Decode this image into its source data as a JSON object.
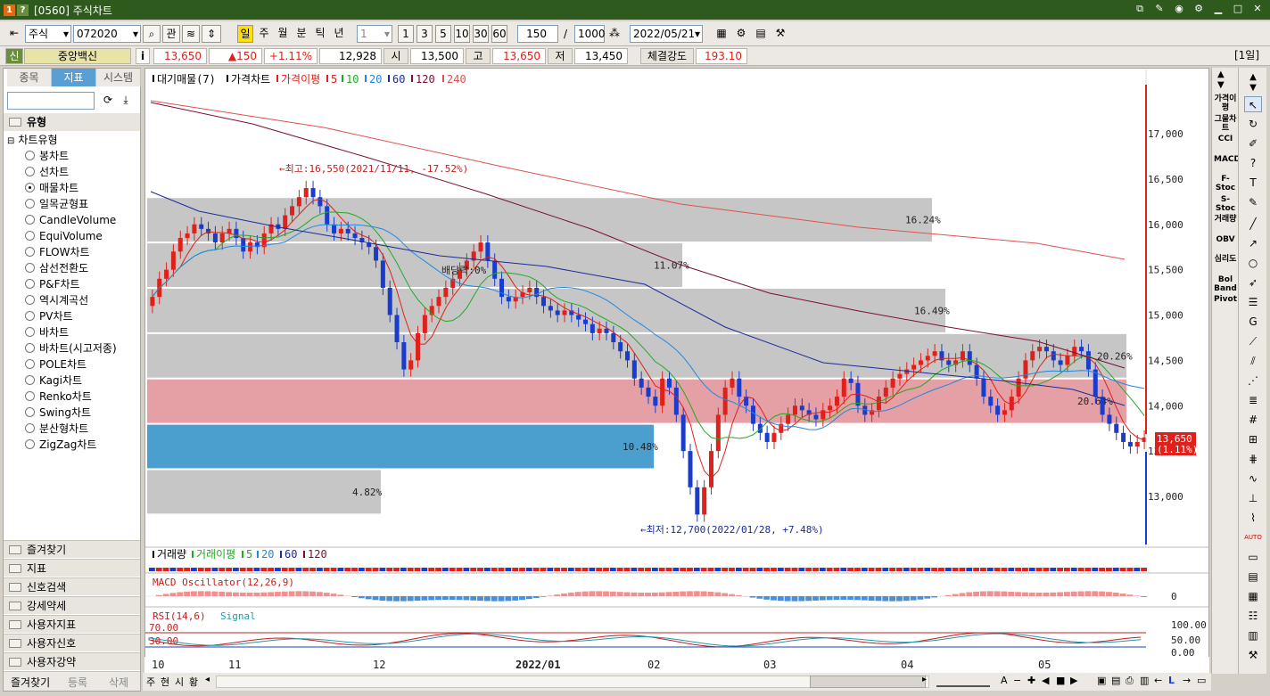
{
  "window": {
    "icon1": "1",
    "icon2": "?",
    "title": "[0560] 주식차트"
  },
  "toolbar": {
    "market": "주식",
    "code": "072020",
    "btn_gwan": "관",
    "periods": [
      "일",
      "주",
      "월",
      "분",
      "틱",
      "년"
    ],
    "interval_value": "1",
    "intervals": [
      "1",
      "3",
      "5",
      "10",
      "30",
      "60"
    ],
    "count": "150",
    "slash": "/",
    "total": "1000",
    "date": "2022/05/21"
  },
  "quote": {
    "badge": "신",
    "name": "중앙백신",
    "info": "i",
    "price": "13,650",
    "change": "▲150",
    "change_pct": "+1.11%",
    "volume": "12,928",
    "open_label": "시",
    "open": "13,500",
    "high_label": "고",
    "high": "13,650",
    "low_label": "저",
    "low": "13,450",
    "strength_label": "체결강도",
    "strength": "193.10",
    "period_badge": "[1일]"
  },
  "left_panel": {
    "tabs": [
      "종목",
      "지표",
      "시스템"
    ],
    "active_tab": "지표",
    "group_title": "유형",
    "subgroup": "차트유형",
    "chart_types": [
      "봉차트",
      "선차트",
      "매물차트",
      "일목균형표",
      "CandleVolume",
      "EquiVolume",
      "FLOW차트",
      "삼선전환도",
      "P&F차트",
      "역시계곡선",
      "PV차트",
      "바차트",
      "바차트(시고저종)",
      "POLE차트",
      "Kagi차트",
      "Renko차트",
      "Swing차트",
      "분산형차트",
      "ZigZag차트"
    ],
    "selected_type": "매물차트",
    "folders": [
      "즐겨찾기",
      "지표",
      "신호검색",
      "강세약세",
      "사용자지표",
      "사용자신호",
      "사용자강약"
    ],
    "footer": [
      "즐겨찾기",
      "등록",
      "삭제"
    ]
  },
  "chart": {
    "legend_main": [
      {
        "text": "대기매물(7)",
        "color": "#000000"
      },
      {
        "text": "가격차트",
        "color": "#000000"
      },
      {
        "text": "가격이평",
        "color": "#e0201a"
      },
      {
        "text": "5",
        "color": "#e0201a"
      },
      {
        "text": "10",
        "color": "#22aa22"
      },
      {
        "text": "20",
        "color": "#2288dd"
      },
      {
        "text": "60",
        "color": "#1a2c99"
      },
      {
        "text": "120",
        "color": "#7a1030"
      },
      {
        "text": "240",
        "color": "#e05050"
      }
    ],
    "legend_volume": [
      {
        "text": "거래량",
        "color": "#000000"
      },
      {
        "text": "거래이평",
        "color": "#22aa22"
      },
      {
        "text": "5",
        "color": "#22aa22"
      },
      {
        "text": "20",
        "color": "#2288dd"
      },
      {
        "text": "60",
        "color": "#1a2c99"
      },
      {
        "text": "120",
        "color": "#7a1030"
      }
    ],
    "legend_macd": "MACD Oscillator(12,26,9)",
    "macd_zero": "0",
    "legend_rsi": "RSI(14,6)",
    "legend_signal": "Signal",
    "rsi_levels": [
      "70.00",
      "30.00"
    ],
    "rsi_axis": [
      "100.00",
      "50.00",
      "0.00"
    ],
    "price_axis": [
      "17,000",
      "16,500",
      "16,000",
      "15,500",
      "15,000",
      "14,500",
      "14,000",
      "13,500",
      "13,000"
    ],
    "current_price_tag": "13,650",
    "current_pct_tag": "(1.11%)",
    "annotations": {
      "high": "←최고:16,550(2021/11/11, -17.52%)",
      "low": "←최저:12,700(2022/01/28, +7.48%)",
      "dividend": "배당락:0%"
    },
    "supply_pct": [
      "16.24%",
      "11.07%",
      "16.49%",
      "20.26%",
      "20.64%",
      "10.48%",
      "4.82%"
    ],
    "x_labels": [
      "10",
      "11",
      "12",
      "2022/01",
      "02",
      "03",
      "04",
      "05"
    ]
  },
  "right_tools": [
    "가격이평",
    "그물차트",
    "CCI",
    "MACD",
    "F-Stoc",
    "S-Stoc",
    "거래량",
    "OBV",
    "심리도",
    "Bol Band",
    "Pivot"
  ],
  "bottom_tabs": [
    "주",
    "현",
    "시",
    "황"
  ],
  "colors": {
    "title_bg": "#2e5a1e",
    "up": "#e0201a",
    "down": "#1a3ccc",
    "accent": "#5a9fd4"
  }
}
